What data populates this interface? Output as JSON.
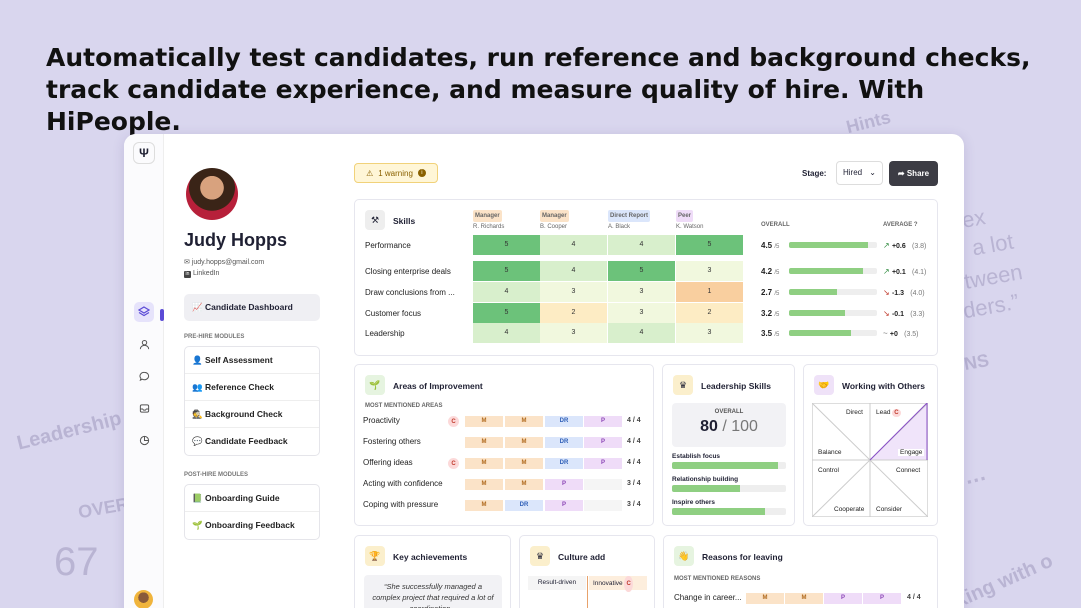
{
  "headline": "Automatically test candidates, run reference and background checks, track candidate experience, and measure quality of hire. With HiPeople.",
  "bg": {
    "hints": "Hints",
    "leadership": "Leadership",
    "over": "OVER",
    "num": "67",
    "x": "ex",
    "a_lot": "a lot",
    "tween": "tween",
    "lders": "lders.”",
    "ns": "NS",
    "working": "king with o",
    "dots": "…"
  },
  "app": {
    "logo": "Ψ",
    "warning": "1 warning",
    "stage_label": "Stage:",
    "stage_value": "Hired",
    "share": "Share"
  },
  "profile": {
    "name": "Judy Hopps",
    "email": "judy.hopps@gmail.com",
    "linkedin": "LinkedIn",
    "dashboard": "Candidate Dashboard",
    "pre_label": "PRE-HIRE MODULES",
    "pre": [
      "Self Assessment",
      "Reference Check",
      "Background Check",
      "Candidate Feedback"
    ],
    "post_label": "POST-HIRE MODULES",
    "post": [
      "Onboarding Guide",
      "Onboarding Feedback"
    ]
  },
  "skills": {
    "title": "Skills",
    "overall": "OVERALL",
    "average": "AVERAGE",
    "refs": [
      {
        "role": "Manager",
        "name": "R. Richards",
        "color": "#fbe3c8"
      },
      {
        "role": "Manager",
        "name": "B. Cooper",
        "color": "#fbe3c8"
      },
      {
        "role": "Direct Report",
        "name": "A. Black",
        "color": "#dbe6fb"
      },
      {
        "role": "Peer",
        "name": "K. Watson",
        "color": "#efdcf8"
      }
    ],
    "rows": [
      {
        "label": "Performance",
        "vals": [
          "5",
          "4",
          "4",
          "5"
        ],
        "score": "4.5",
        "denom": "/5",
        "trend": "↗",
        "delta": "+0.6",
        "avg": "(3.8)",
        "fill": 0.9
      },
      {
        "label": "Closing enterprise deals",
        "vals": [
          "5",
          "4",
          "5",
          "3"
        ],
        "score": "4.2",
        "denom": "/5",
        "trend": "↗",
        "delta": "+0.1",
        "avg": "(4.1)",
        "fill": 0.84
      },
      {
        "label": "Draw conclusions from ...",
        "vals": [
          "4",
          "3",
          "3",
          "1"
        ],
        "score": "2.7",
        "denom": "/5",
        "trend": "↘",
        "delta": "-1.3",
        "avg": "(4.0)",
        "fill": 0.54
      },
      {
        "label": "Customer focus",
        "vals": [
          "5",
          "2",
          "3",
          "2"
        ],
        "score": "3.2",
        "denom": "/5",
        "trend": "↘",
        "delta": "-0.1",
        "avg": "(3.3)",
        "fill": 0.64
      },
      {
        "label": "Leadership",
        "vals": [
          "4",
          "3",
          "4",
          "3"
        ],
        "score": "3.5",
        "denom": "/5",
        "trend": "~",
        "delta": "+0",
        "avg": "(3.5)",
        "fill": 0.7
      }
    ]
  },
  "improve": {
    "title": "Areas of Improvement",
    "sub": "MOST MENTIONED AREAS",
    "rows": [
      {
        "label": "Proactivity",
        "c": "C",
        "chips": [
          "M",
          "M",
          "DR",
          "P"
        ],
        "ratio": "4 / 4"
      },
      {
        "label": "Fostering others",
        "c": "",
        "chips": [
          "M",
          "M",
          "DR",
          "P"
        ],
        "ratio": "4 / 4"
      },
      {
        "label": "Offering ideas",
        "c": "C",
        "chips": [
          "M",
          "M",
          "DR",
          "P"
        ],
        "ratio": "4 / 4"
      },
      {
        "label": "Acting with confidence",
        "c": "",
        "chips": [
          "M",
          "M",
          "P",
          ""
        ],
        "ratio": "3 / 4"
      },
      {
        "label": "Coping with pressure",
        "c": "",
        "chips": [
          "M",
          "DR",
          "P",
          ""
        ],
        "ratio": "3 / 4"
      }
    ]
  },
  "leadership": {
    "title": "Leadership Skills",
    "overall": "OVERALL",
    "score": "80",
    "max": "/ 100",
    "bars": [
      {
        "label": "Establish focus",
        "fill": 0.93
      },
      {
        "label": "Relationship building",
        "fill": 0.6
      },
      {
        "label": "Inspire others",
        "fill": 0.82
      }
    ]
  },
  "working": {
    "title": "Working with Others",
    "labels": {
      "direct": "Direct",
      "lead": "Lead",
      "c": "C",
      "balance": "Balance",
      "engage": "Engage",
      "control": "Control",
      "connect": "Connect",
      "cooperate": "Cooperate",
      "consider": "Consider"
    }
  },
  "achievements": {
    "title": "Key achievements",
    "quote": "“She successfully managed a complex project that required a lot of coordination..."
  },
  "culture": {
    "title": "Culture add",
    "left": "Result-driven",
    "right": "Innovative",
    "c": "C"
  },
  "reasons": {
    "title": "Reasons for leaving",
    "sub": "MOST MENTIONED REASONS",
    "row": {
      "label": "Change in career...",
      "chips": [
        "M",
        "M",
        "P",
        "P"
      ],
      "ratio": "4 / 4"
    }
  }
}
